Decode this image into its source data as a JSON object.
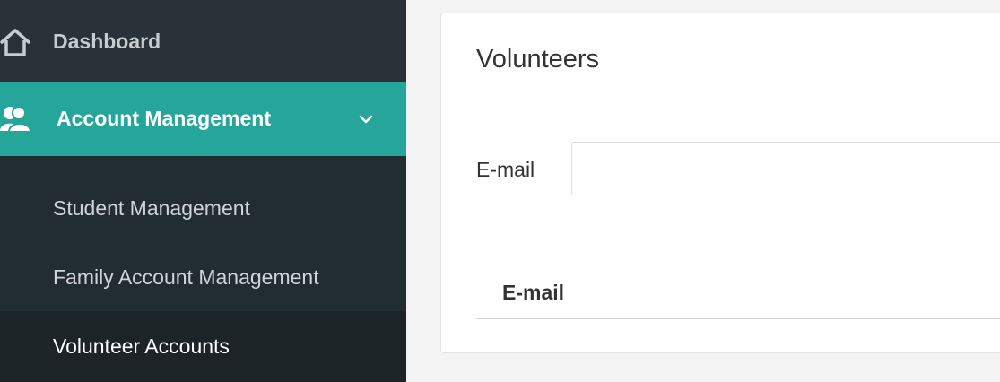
{
  "sidebar": {
    "dashboard": {
      "label": "Dashboard",
      "icon": "home-icon"
    },
    "account_management": {
      "label": "Account Management",
      "icon": "users-icon",
      "chevron": "chevron-down-icon"
    },
    "sub_items": [
      {
        "label": "Student Management"
      },
      {
        "label": "Family Account Management"
      },
      {
        "label": "Volunteer Accounts"
      }
    ]
  },
  "main": {
    "title": "Volunteers",
    "search": {
      "label": "E-mail",
      "value": "",
      "placeholder": ""
    },
    "table": {
      "columns": [
        "E-mail"
      ]
    }
  },
  "colors": {
    "sidebar_bg": "#222d32",
    "accent": "#26a69a",
    "page_bg": "#f3f3f3"
  }
}
